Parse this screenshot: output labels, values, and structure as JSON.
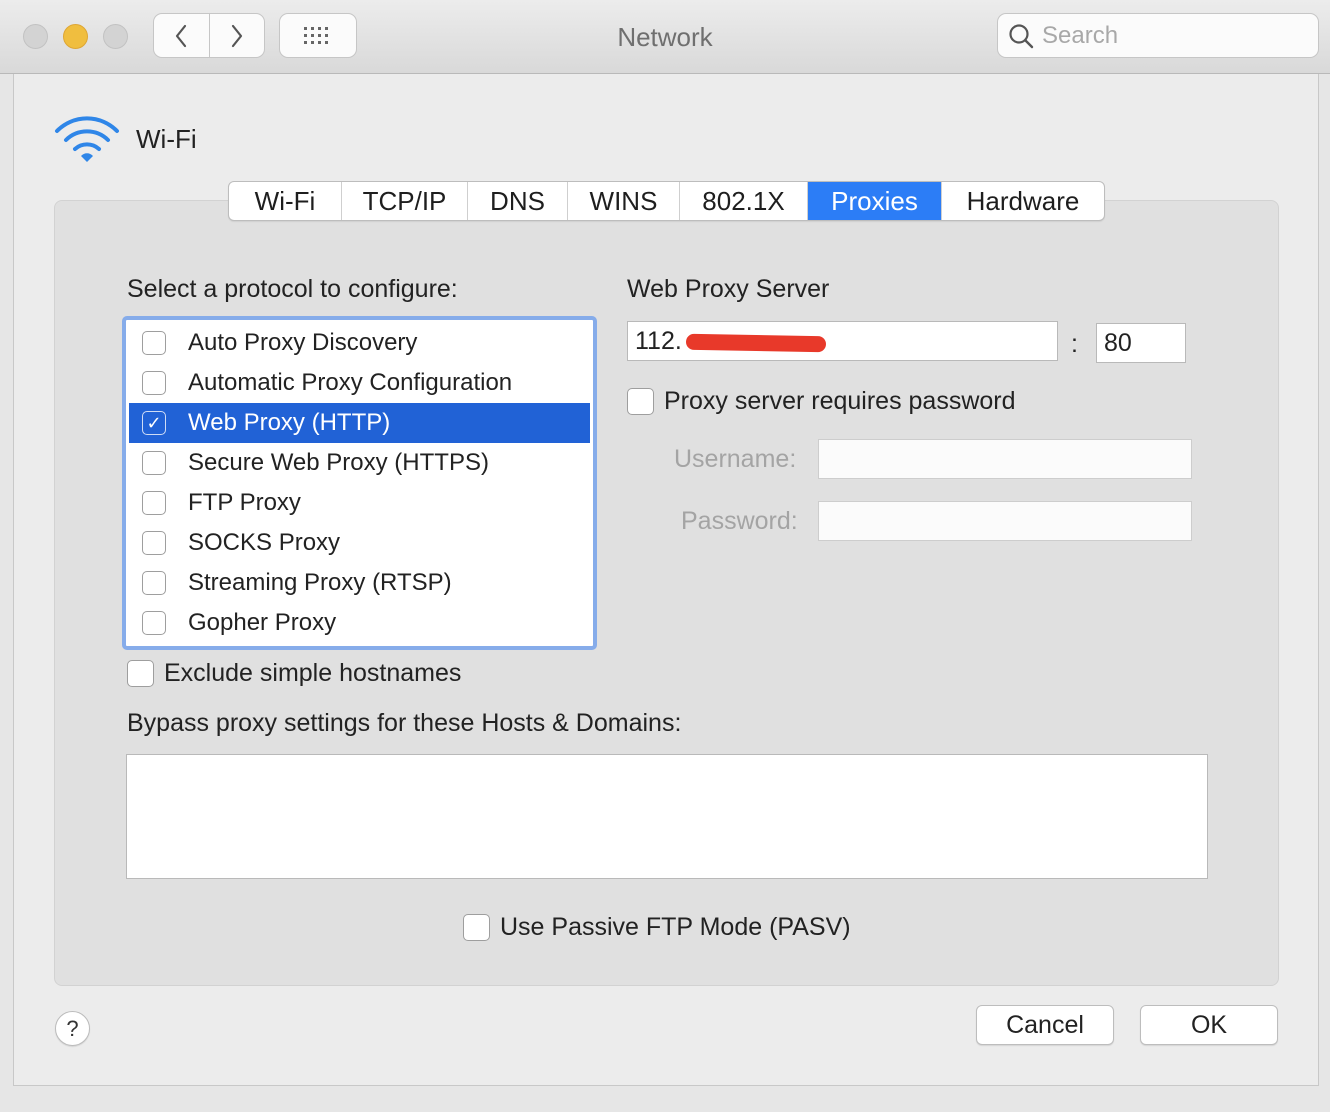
{
  "window": {
    "title": "Network",
    "search_placeholder": "Search"
  },
  "interface": {
    "name": "Wi-Fi",
    "icon": "wifi-icon"
  },
  "tabs": [
    {
      "label": "Wi-Fi",
      "active": false
    },
    {
      "label": "TCP/IP",
      "active": false
    },
    {
      "label": "DNS",
      "active": false
    },
    {
      "label": "WINS",
      "active": false
    },
    {
      "label": "802.1X",
      "active": false
    },
    {
      "label": "Proxies",
      "active": true
    },
    {
      "label": "Hardware",
      "active": false
    }
  ],
  "protocols": {
    "heading": "Select a protocol to configure:",
    "items": [
      {
        "label": "Auto Proxy Discovery",
        "checked": false,
        "selected": false
      },
      {
        "label": "Automatic Proxy Configuration",
        "checked": false,
        "selected": false
      },
      {
        "label": "Web Proxy (HTTP)",
        "checked": true,
        "selected": true
      },
      {
        "label": "Secure Web Proxy (HTTPS)",
        "checked": false,
        "selected": false
      },
      {
        "label": "FTP Proxy",
        "checked": false,
        "selected": false
      },
      {
        "label": "SOCKS Proxy",
        "checked": false,
        "selected": false
      },
      {
        "label": "Streaming Proxy (RTSP)",
        "checked": false,
        "selected": false
      },
      {
        "label": "Gopher Proxy",
        "checked": false,
        "selected": false
      }
    ]
  },
  "server": {
    "heading": "Web Proxy Server",
    "address": "112.",
    "separator": ":",
    "port": "80",
    "requires_password_label": "Proxy server requires password",
    "username_label": "Username:",
    "password_label": "Password:",
    "username": "",
    "password": ""
  },
  "exclude_simple_label": "Exclude simple hostnames",
  "bypass": {
    "label": "Bypass proxy settings for these Hosts & Domains:",
    "value": ""
  },
  "passive_ftp_label": "Use Passive FTP Mode (PASV)",
  "buttons": {
    "help": "?",
    "cancel": "Cancel",
    "ok": "OK"
  },
  "colors": {
    "accent": "#2c7df6",
    "selection": "#2162d6",
    "minimize": "#f0be3f",
    "redaction": "#e8392a"
  }
}
